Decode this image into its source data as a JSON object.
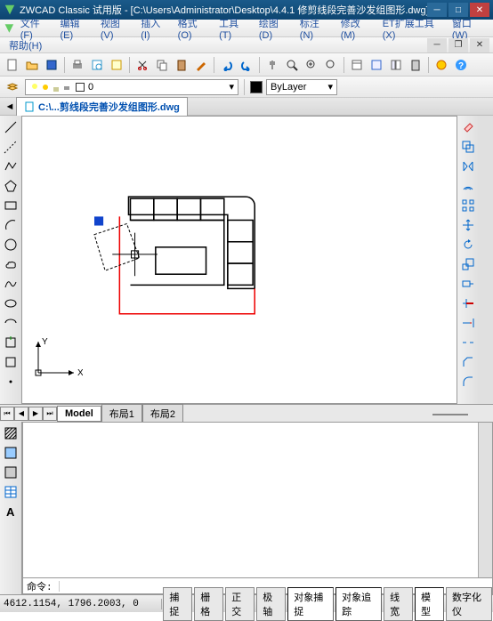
{
  "title": "ZWCAD Classic 试用版 - [C:\\Users\\Administrator\\Desktop\\4.4.1 修剪线段完善沙发组图形.dwg]",
  "menus": {
    "file": "文件(F)",
    "edit": "编辑(E)",
    "view": "视图(V)",
    "insert": "插入(I)",
    "format": "格式(O)",
    "tools": "工具(T)",
    "draw": "绘图(D)",
    "annotate": "标注(N)",
    "modify": "修改(M)",
    "ettools": "ET扩展工具(X)",
    "window": "窗口(W)",
    "help": "帮助(H)"
  },
  "doc": {
    "tab_label": "C:\\...剪线段完善沙发组图形.dwg"
  },
  "props": {
    "layer": "0",
    "layer_linetype": "ByLayer"
  },
  "model_tabs": {
    "model": "Model",
    "layout1": "布局1",
    "layout2": "布局2"
  },
  "command": {
    "prompt": "命令:"
  },
  "status": {
    "coords": "4612.1154, 1796.2003, 0",
    "snap": "捕捉",
    "grid": "栅格",
    "ortho": "正交",
    "polar": "极轴",
    "osnap": "对象捕捉",
    "otrack": "对象追踪",
    "lwt": "线宽",
    "model": "模型",
    "digitizer": "数字化仪"
  },
  "ucs": {
    "x": "X",
    "y": "Y"
  }
}
